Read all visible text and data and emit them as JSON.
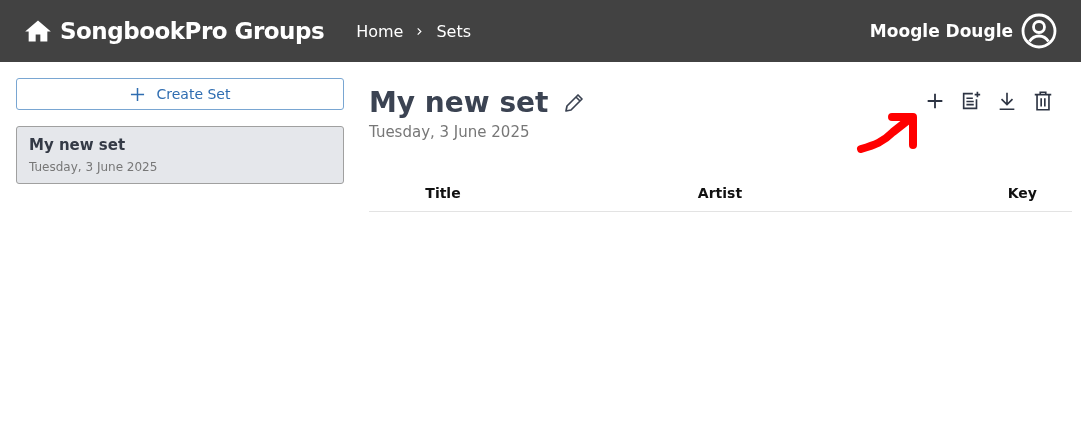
{
  "header": {
    "title": "SongbookPro Groups",
    "breadcrumbs": [
      "Home",
      "Sets"
    ],
    "user": "Moogle Dougle"
  },
  "sidebar": {
    "create_button": "Create Set",
    "items": [
      {
        "name": "My new set",
        "date": "Tuesday, 3 June 2025",
        "selected": true
      }
    ]
  },
  "set": {
    "title": "My new set",
    "date": "Tuesday, 3 June 2025"
  },
  "table": {
    "columns": [
      "Title",
      "Artist",
      "Key"
    ]
  }
}
